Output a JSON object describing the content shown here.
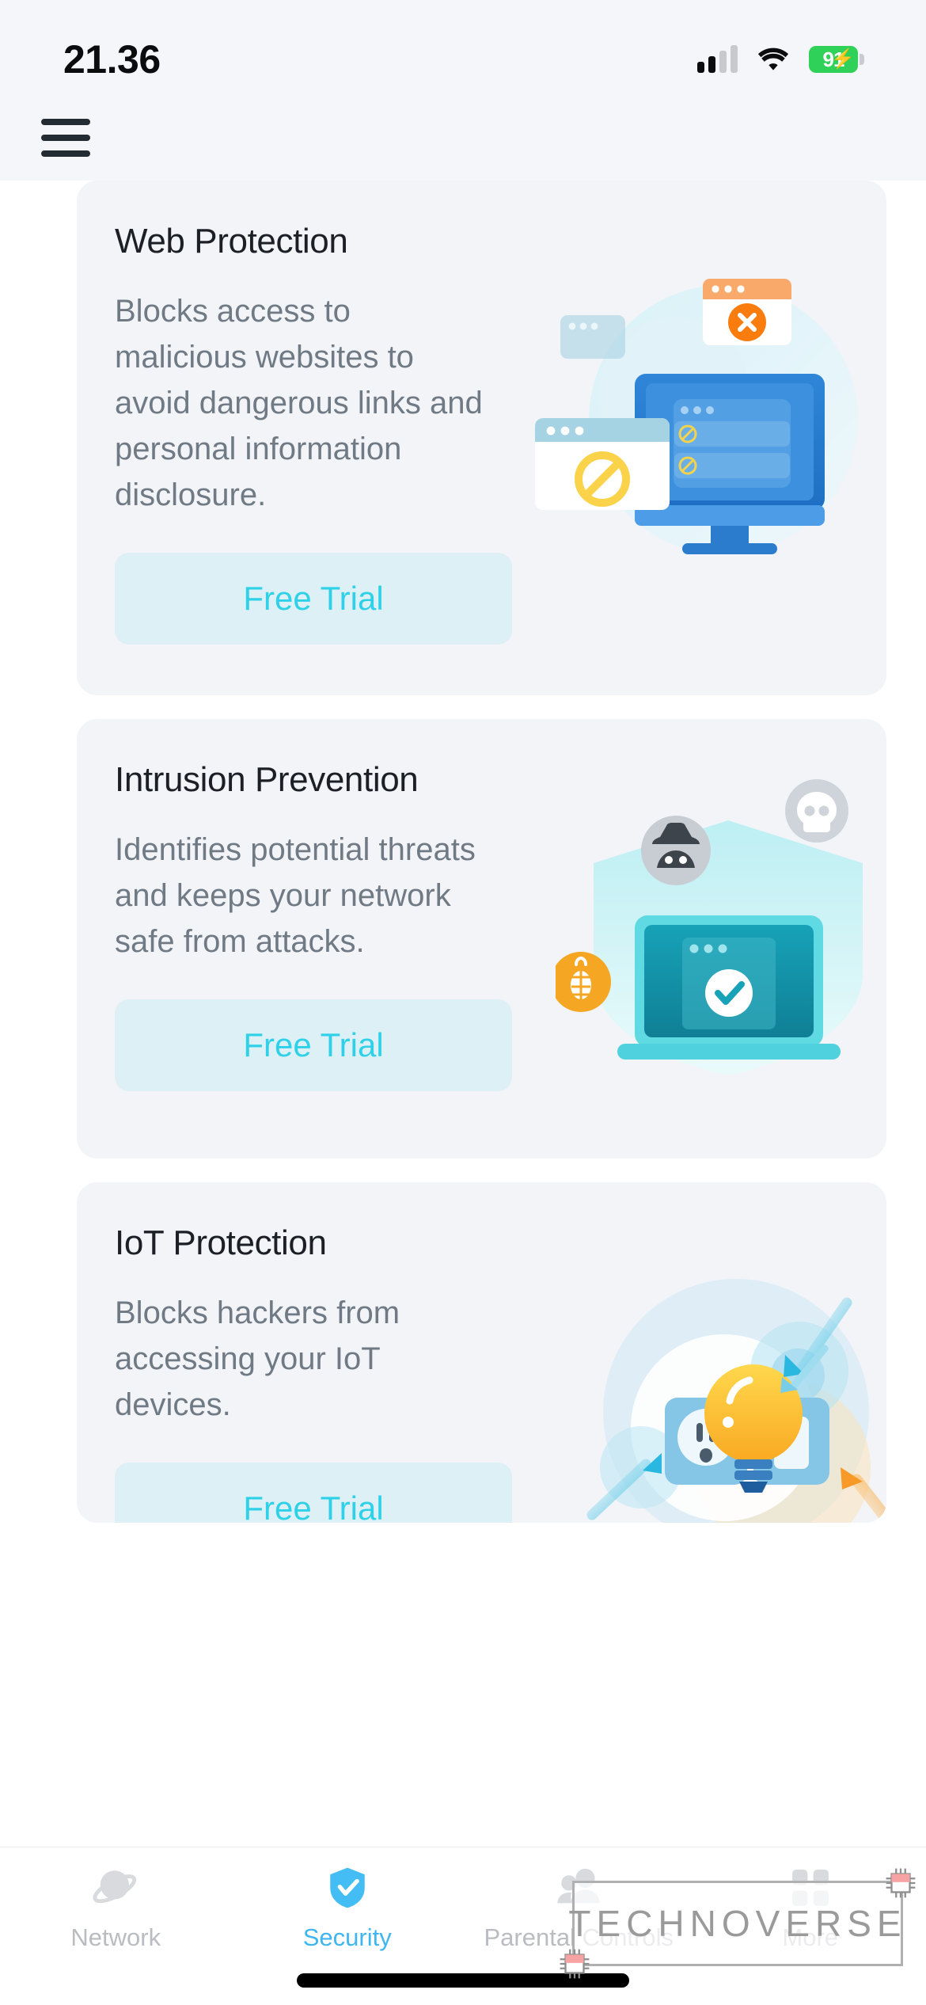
{
  "status_bar": {
    "time": "21.36",
    "battery_percent": "91",
    "signal_icon": "cellular-signal-icon",
    "signal_bars_filled": 2,
    "signal_bars_total": 4,
    "wifi_icon": "wifi-icon",
    "battery_icon": "battery-charging-icon",
    "charging_bolt_icon": "lightning-bolt-icon",
    "battery_color": "#30d158"
  },
  "header": {
    "menu_icon": "hamburger-menu-icon"
  },
  "theme": {
    "card_bg": "#f2f4f8",
    "page_bg": "#f4f6f9",
    "accent": "#2ed1e8",
    "accent_soft": "#ddf0f6",
    "title_color": "#1c2026",
    "body_color": "#707a85",
    "active_tab_color": "#3fb6f0",
    "inactive_tab_color": "#b9bcc1"
  },
  "cards": [
    {
      "title": "Web Protection",
      "description": "Blocks access to malicious websites to avoid dangerous links and personal information disclosure.",
      "button_label": "Free Trial",
      "illustration": "web-protection-illustration"
    },
    {
      "title": "Intrusion Prevention",
      "description": "Identifies potential threats and keeps your network safe from attacks.",
      "button_label": "Free Trial",
      "illustration": "intrusion-prevention-illustration"
    },
    {
      "title": "IoT Protection",
      "description": "Blocks hackers from accessing your IoT devices.",
      "button_label": "Free Trial",
      "illustration": "iot-protection-illustration"
    }
  ],
  "tabbar": {
    "items": [
      {
        "label": "Network",
        "icon": "planet-icon",
        "active": false
      },
      {
        "label": "Security",
        "icon": "shield-check-icon",
        "active": true
      },
      {
        "label": "Parental Controls",
        "icon": "people-icon",
        "active": false
      },
      {
        "label": "More",
        "icon": "grid-squares-icon",
        "active": false
      }
    ]
  },
  "watermark": {
    "text": "TECHNOVERSE",
    "chip_icon": "microchip-icon"
  }
}
